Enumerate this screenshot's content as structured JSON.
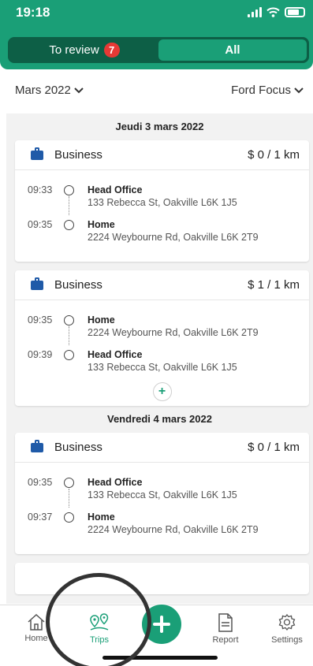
{
  "status": {
    "time": "19:18"
  },
  "tabs": {
    "review_label": "To review",
    "review_count": "7",
    "all_label": "All"
  },
  "filters": {
    "month": "Mars 2022",
    "vehicle": "Ford Focus"
  },
  "days": [
    {
      "label": "Jeudi 3 mars 2022",
      "trips": [
        {
          "category": "Business",
          "cost": "$ 0 / 1 km",
          "stops": [
            {
              "time": "09:33",
              "name": "Head Office",
              "address": "133 Rebecca St, Oakville L6K 1J5"
            },
            {
              "time": "09:35",
              "name": "Home",
              "address": "2224 Weybourne Rd, Oakville L6K 2T9"
            }
          ]
        },
        {
          "category": "Business",
          "cost": "$ 1 / 1 km",
          "stops": [
            {
              "time": "09:35",
              "name": "Home",
              "address": "2224 Weybourne Rd, Oakville L6K 2T9"
            },
            {
              "time": "09:39",
              "name": "Head Office",
              "address": "133 Rebecca St, Oakville L6K 1J5"
            }
          ]
        }
      ]
    },
    {
      "label": "Vendredi 4 mars 2022",
      "trips": [
        {
          "category": "Business",
          "cost": "$ 0 / 1 km",
          "stops": [
            {
              "time": "09:35",
              "name": "Head Office",
              "address": "133 Rebecca St, Oakville L6K 1J5"
            },
            {
              "time": "09:37",
              "name": "Home",
              "address": "2224 Weybourne Rd, Oakville L6K 2T9"
            }
          ]
        }
      ]
    }
  ],
  "add_button": "+",
  "tabbar": {
    "home": "Home",
    "trips": "Trips",
    "report": "Report",
    "settings": "Settings"
  },
  "colors": {
    "accent": "#1a9f77",
    "accent_dark": "#0d5f46",
    "badge": "#e53935",
    "briefcase": "#1f5aa8"
  }
}
